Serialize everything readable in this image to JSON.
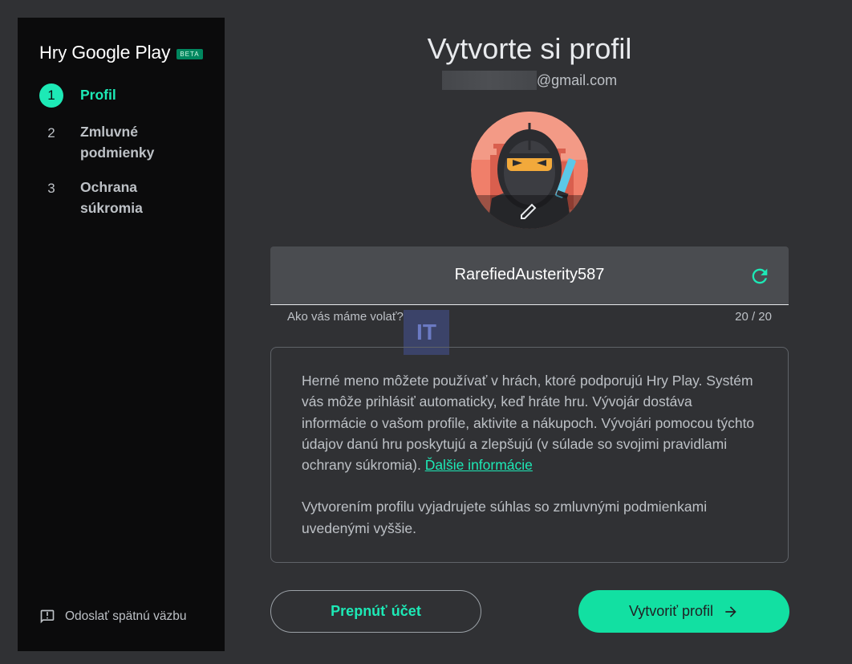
{
  "sidebar": {
    "brand": {
      "hry": "Hry",
      "google_play": "Google Play",
      "badge": "BETA"
    },
    "steps": [
      {
        "number": "1",
        "label": "Profil",
        "active": true
      },
      {
        "number": "2",
        "label": "Zmluvné podmienky",
        "active": false
      },
      {
        "number": "3",
        "label": "Ochrana súkromia",
        "active": false
      }
    ],
    "feedback_label": "Odoslať spätnú väzbu"
  },
  "main": {
    "title": "Vytvorte si profil",
    "email_suffix": "@gmail.com",
    "name_field": {
      "value": "RarefiedAusterity587",
      "helper": "Ako vás máme volať?",
      "counter": "20 / 20"
    },
    "watermark": "IT",
    "info": {
      "paragraph1": "Herné meno môžete používať v hrách, ktoré podporujú Hry Play. Systém vás môže prihlásiť automaticky, keď hráte hru. Vývojár dostáva informácie o vašom profile, aktivite a nákupoch. Vývojári pomocou týchto údajov danú hru poskytujú a zlepšujú (v súlade so svojimi pravidlami ochrany súkromia).",
      "link": "Ďalšie informácie",
      "paragraph2": "Vytvorením profilu vyjadrujete súhlas so zmluvnými podmienkami uvedenými vyššie."
    },
    "buttons": {
      "switch_account": "Prepnúť účet",
      "create_profile": "Vytvoriť profil"
    }
  },
  "colors": {
    "accent": "#1de9b6",
    "primary_button": "#12e0a2",
    "background": "#303134",
    "sidebar": "#0b0b0c"
  },
  "icons": [
    "feedback-icon",
    "refresh-icon",
    "arrow-right-icon",
    "edit-pencil-icon"
  ]
}
